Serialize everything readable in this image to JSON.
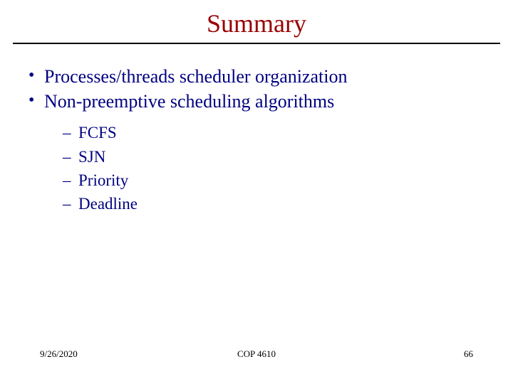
{
  "title": "Summary",
  "bullets": [
    "Processes/threads scheduler organization",
    "Non-preemptive scheduling algorithms"
  ],
  "subitems": [
    "FCFS",
    "SJN",
    "Priority",
    "Deadline"
  ],
  "footer": {
    "date": "9/26/2020",
    "course": "COP 4610",
    "page": "66"
  }
}
